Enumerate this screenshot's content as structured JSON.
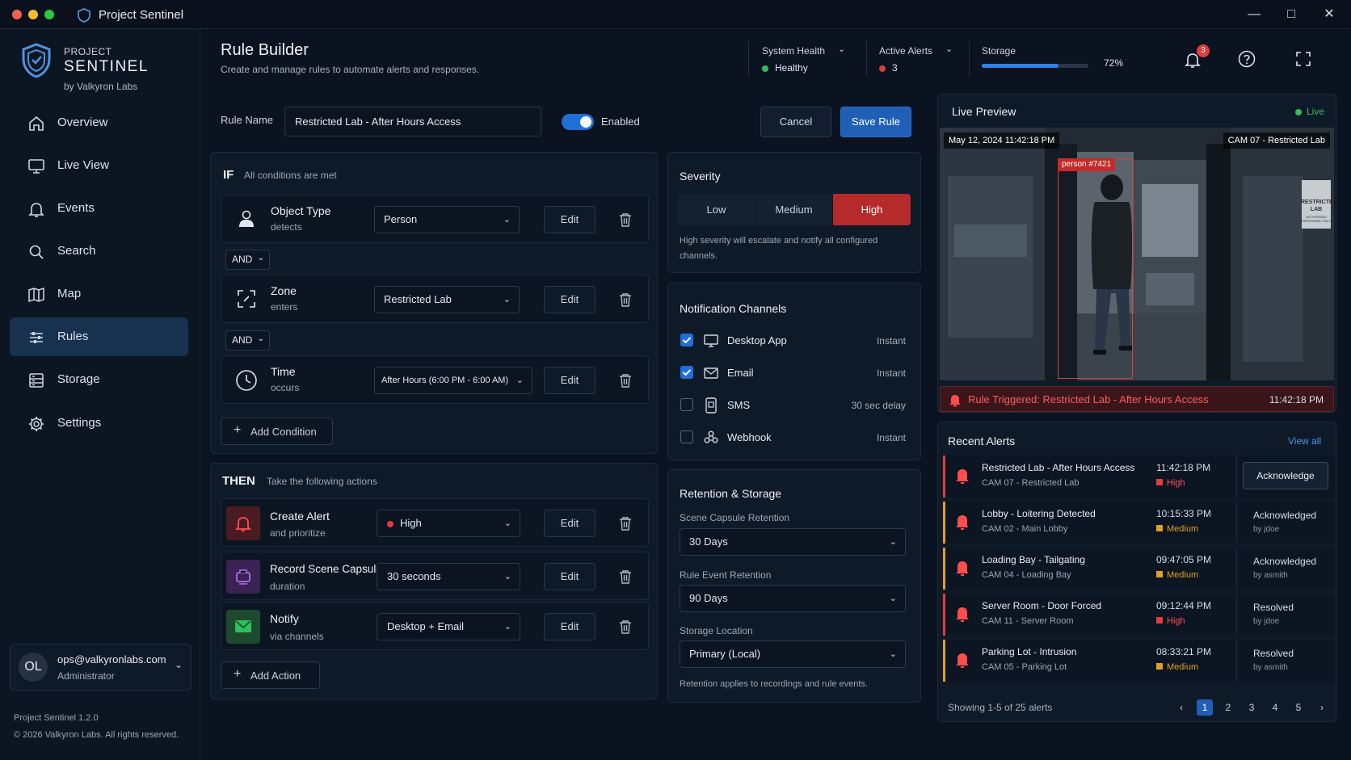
{
  "window": {
    "title": "Project Sentinel"
  },
  "brand": {
    "line1": "PROJECT",
    "line2": "SENTINEL",
    "line3": "by Valkyron Labs"
  },
  "nav": [
    {
      "label": "Overview",
      "icon": "home-icon"
    },
    {
      "label": "Live View",
      "icon": "monitor-icon"
    },
    {
      "label": "Events",
      "icon": "bell-icon"
    },
    {
      "label": "Search",
      "icon": "search-icon"
    },
    {
      "label": "Map",
      "icon": "map-icon"
    },
    {
      "label": "Rules",
      "icon": "sliders-icon",
      "active": true
    },
    {
      "label": "Storage",
      "icon": "storage-icon"
    },
    {
      "label": "Settings",
      "icon": "gear-icon"
    }
  ],
  "user": {
    "initials": "OL",
    "email": "ops@valkyronlabs.com",
    "role": "Administrator"
  },
  "footer": {
    "version": "Project Sentinel 1.2.0",
    "copyright": "© 2026 Valkyron Labs. All rights reserved."
  },
  "header": {
    "title": "Rule Builder",
    "subtitle": "Create and manage rules to automate alerts and responses.",
    "system_health": {
      "label": "System Health",
      "value": "Healthy",
      "color": "#2fbf5a"
    },
    "active_alerts": {
      "label": "Active Alerts",
      "value": "3",
      "color": "#e23c3c"
    },
    "storage": {
      "label": "Storage",
      "value": "72%",
      "fraction": 0.72
    },
    "notification_count": "3"
  },
  "rule": {
    "name_label": "Rule Name",
    "name_value": "Restricted Lab - After Hours Access",
    "enabled_label": "Enabled",
    "cancel_label": "Cancel",
    "save_label": "Save Rule"
  },
  "conditions": {
    "if_label": "IF",
    "if_sub": "All conditions are met",
    "items": [
      {
        "title": "Object Type",
        "sub": "detects",
        "value": "Person",
        "icon": "person-icon"
      },
      {
        "title": "Zone",
        "sub": "enters",
        "value": "Restricted Lab",
        "icon": "zone-icon"
      },
      {
        "title": "Time",
        "sub": "occurs",
        "value": "After Hours (6:00 PM - 6:00 AM)",
        "icon": "clock-icon"
      }
    ],
    "and_label": "AND",
    "edit_label": "Edit",
    "add_label": "Add Condition"
  },
  "actions": {
    "then_label": "THEN",
    "then_sub": "Take the following actions",
    "items": [
      {
        "title": "Create Alert",
        "sub": "and prioritize",
        "value": "High",
        "icon": "alert-bell-icon",
        "color": "#e23c3c"
      },
      {
        "title": "Record Scene Capsule",
        "sub": "duration",
        "value": "30 seconds",
        "icon": "capsule-icon",
        "color": "#a05ad8"
      },
      {
        "title": "Notify",
        "sub": "via channels",
        "value": "Desktop + Email",
        "icon": "mail-icon",
        "color": "#2fbf5a"
      }
    ],
    "edit_label": "Edit",
    "add_label": "Add Action"
  },
  "severity": {
    "title": "Severity",
    "options": [
      "Low",
      "Medium",
      "High"
    ],
    "selected": "High",
    "note": "High severity will escalate and notify all configured channels."
  },
  "channels": {
    "title": "Notification Channels",
    "items": [
      {
        "name": "Desktop App",
        "delay": "Instant",
        "checked": true,
        "icon": "desktop-icon"
      },
      {
        "name": "Email",
        "delay": "Instant",
        "checked": true,
        "icon": "envelope-icon"
      },
      {
        "name": "SMS",
        "delay": "30 sec delay",
        "checked": false,
        "icon": "phone-icon"
      },
      {
        "name": "Webhook",
        "delay": "Instant",
        "checked": false,
        "icon": "webhook-icon"
      }
    ]
  },
  "retention": {
    "title": "Retention & Storage",
    "scene_label": "Scene Capsule Retention",
    "scene_value": "30 Days",
    "event_label": "Rule Event Retention",
    "event_value": "90 Days",
    "location_label": "Storage Location",
    "location_value": "Primary (Local)",
    "note": "Retention applies to recordings and rule events."
  },
  "preview": {
    "title": "Live Preview",
    "status": "Live",
    "timestamp": "May 12, 2024  11:42:18 PM",
    "camera": "CAM 07 - Restricted Lab",
    "detection": "person #7421",
    "sign": "RESTRICTED LAB",
    "sign_small": "AUTHORIZED PERSONNEL ONLY",
    "trigger_text": "Rule Triggered: Restricted Lab - After Hours Access",
    "trigger_time": "11:42:18 PM"
  },
  "alerts": {
    "title": "Recent Alerts",
    "view_all": "View all",
    "items": [
      {
        "title": "Restricted Lab - After Hours Access",
        "camera": "CAM 07 - Restricted Lab",
        "time": "11:42:18 PM",
        "severity": "High",
        "status": "Acknowledge",
        "by": "",
        "color": "#e23c3c"
      },
      {
        "title": "Lobby - Loitering Detected",
        "camera": "CAM 02 - Main Lobby",
        "time": "10:15:33 PM",
        "severity": "Medium",
        "status": "Acknowledged",
        "by": "by jdoe",
        "color": "#e0a020"
      },
      {
        "title": "Loading Bay - Tailgating",
        "camera": "CAM 04 - Loading Bay",
        "time": "09:47:05 PM",
        "severity": "Medium",
        "status": "Acknowledged",
        "by": "by asmith",
        "color": "#e0a020"
      },
      {
        "title": "Server Room - Door Forced",
        "camera": "CAM 11 - Server Room",
        "time": "09:12:44 PM",
        "severity": "High",
        "status": "Resolved",
        "by": "by jdoe",
        "color": "#e23c3c"
      },
      {
        "title": "Parking Lot - Intrusion",
        "camera": "CAM 05 - Parking Lot",
        "time": "08:33:21 PM",
        "severity": "Medium",
        "status": "Resolved",
        "by": "by asmith",
        "color": "#e0a020"
      }
    ],
    "showing": "Showing 1-5 of 25 alerts",
    "pages": [
      "1",
      "2",
      "3",
      "4",
      "5"
    ],
    "current_page": "1"
  }
}
